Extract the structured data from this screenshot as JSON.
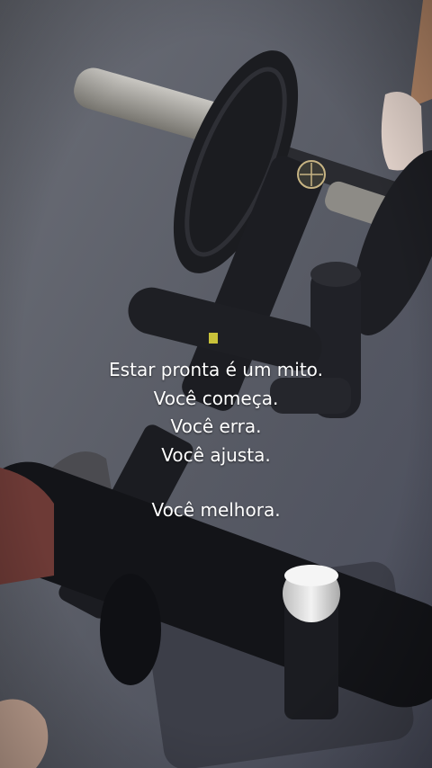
{
  "caption": {
    "lines": [
      "Estar pronta é um mito.",
      "Você começa.",
      "Você erra.",
      "Você ajusta.",
      "Você melhora."
    ]
  },
  "colors": {
    "floor": "#5a5d66",
    "equipment": "#1c1d22",
    "caption_text": "#ffffff"
  }
}
